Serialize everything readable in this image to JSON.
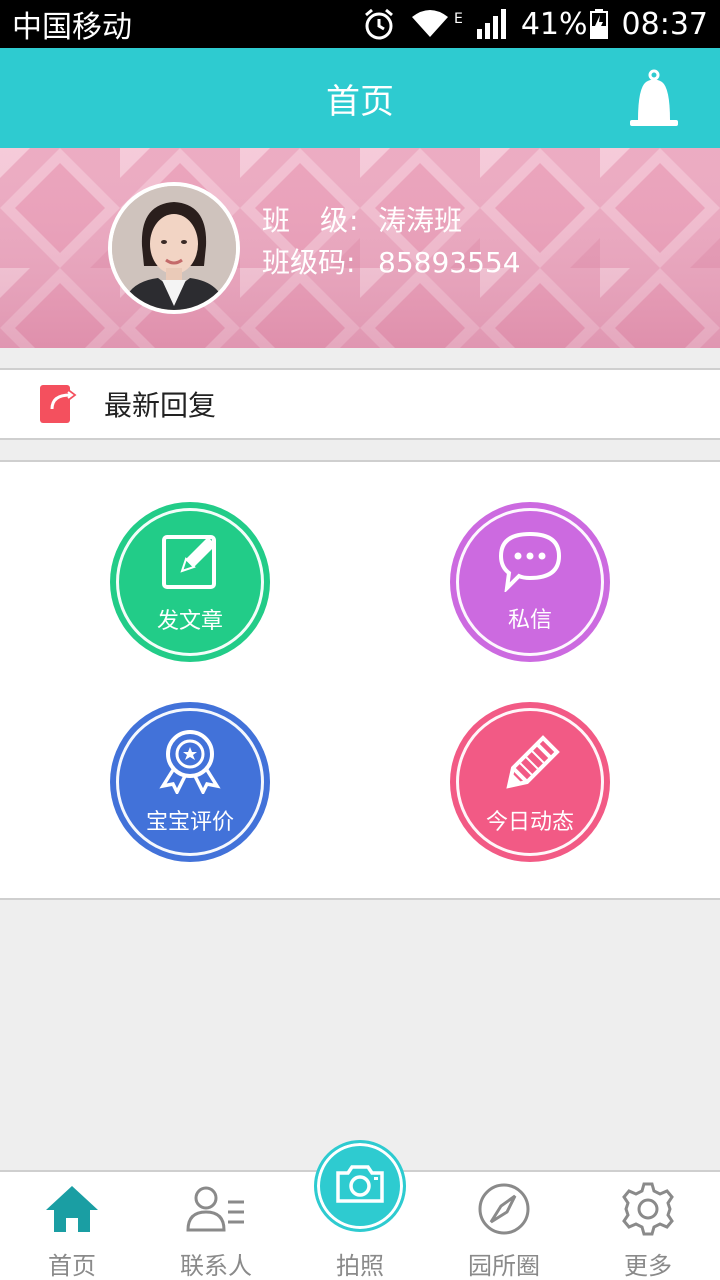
{
  "status_bar": {
    "carrier": "中国移动",
    "network": "E",
    "battery": "41%",
    "time": "08:37"
  },
  "header": {
    "title": "首页",
    "notification_icon": "bell-icon"
  },
  "profile": {
    "class_label": "班　级:",
    "class_value": "涛涛班",
    "code_label": "班级码:",
    "code_value": "85893554"
  },
  "latest_reply": {
    "label": "最新回复",
    "icon": "reply-icon"
  },
  "actions": [
    {
      "label": "发文章",
      "icon": "edit-icon",
      "color": "#22cc88"
    },
    {
      "label": "私信",
      "icon": "chat-icon",
      "color": "#cc6ae0"
    },
    {
      "label": "宝宝评价",
      "icon": "badge-icon",
      "color": "#4272d9"
    },
    {
      "label": "今日动态",
      "icon": "pencil-icon",
      "color": "#f25a85"
    }
  ],
  "bottom_nav": {
    "home": "首页",
    "contacts": "联系人",
    "camera": "拍照",
    "circle": "园所圈",
    "more": "更多"
  },
  "colors": {
    "accent": "#2ecbd0",
    "banner": "#eba7bf",
    "active_nav": "#1a9ea3",
    "inactive_nav": "#8a8a8a"
  }
}
